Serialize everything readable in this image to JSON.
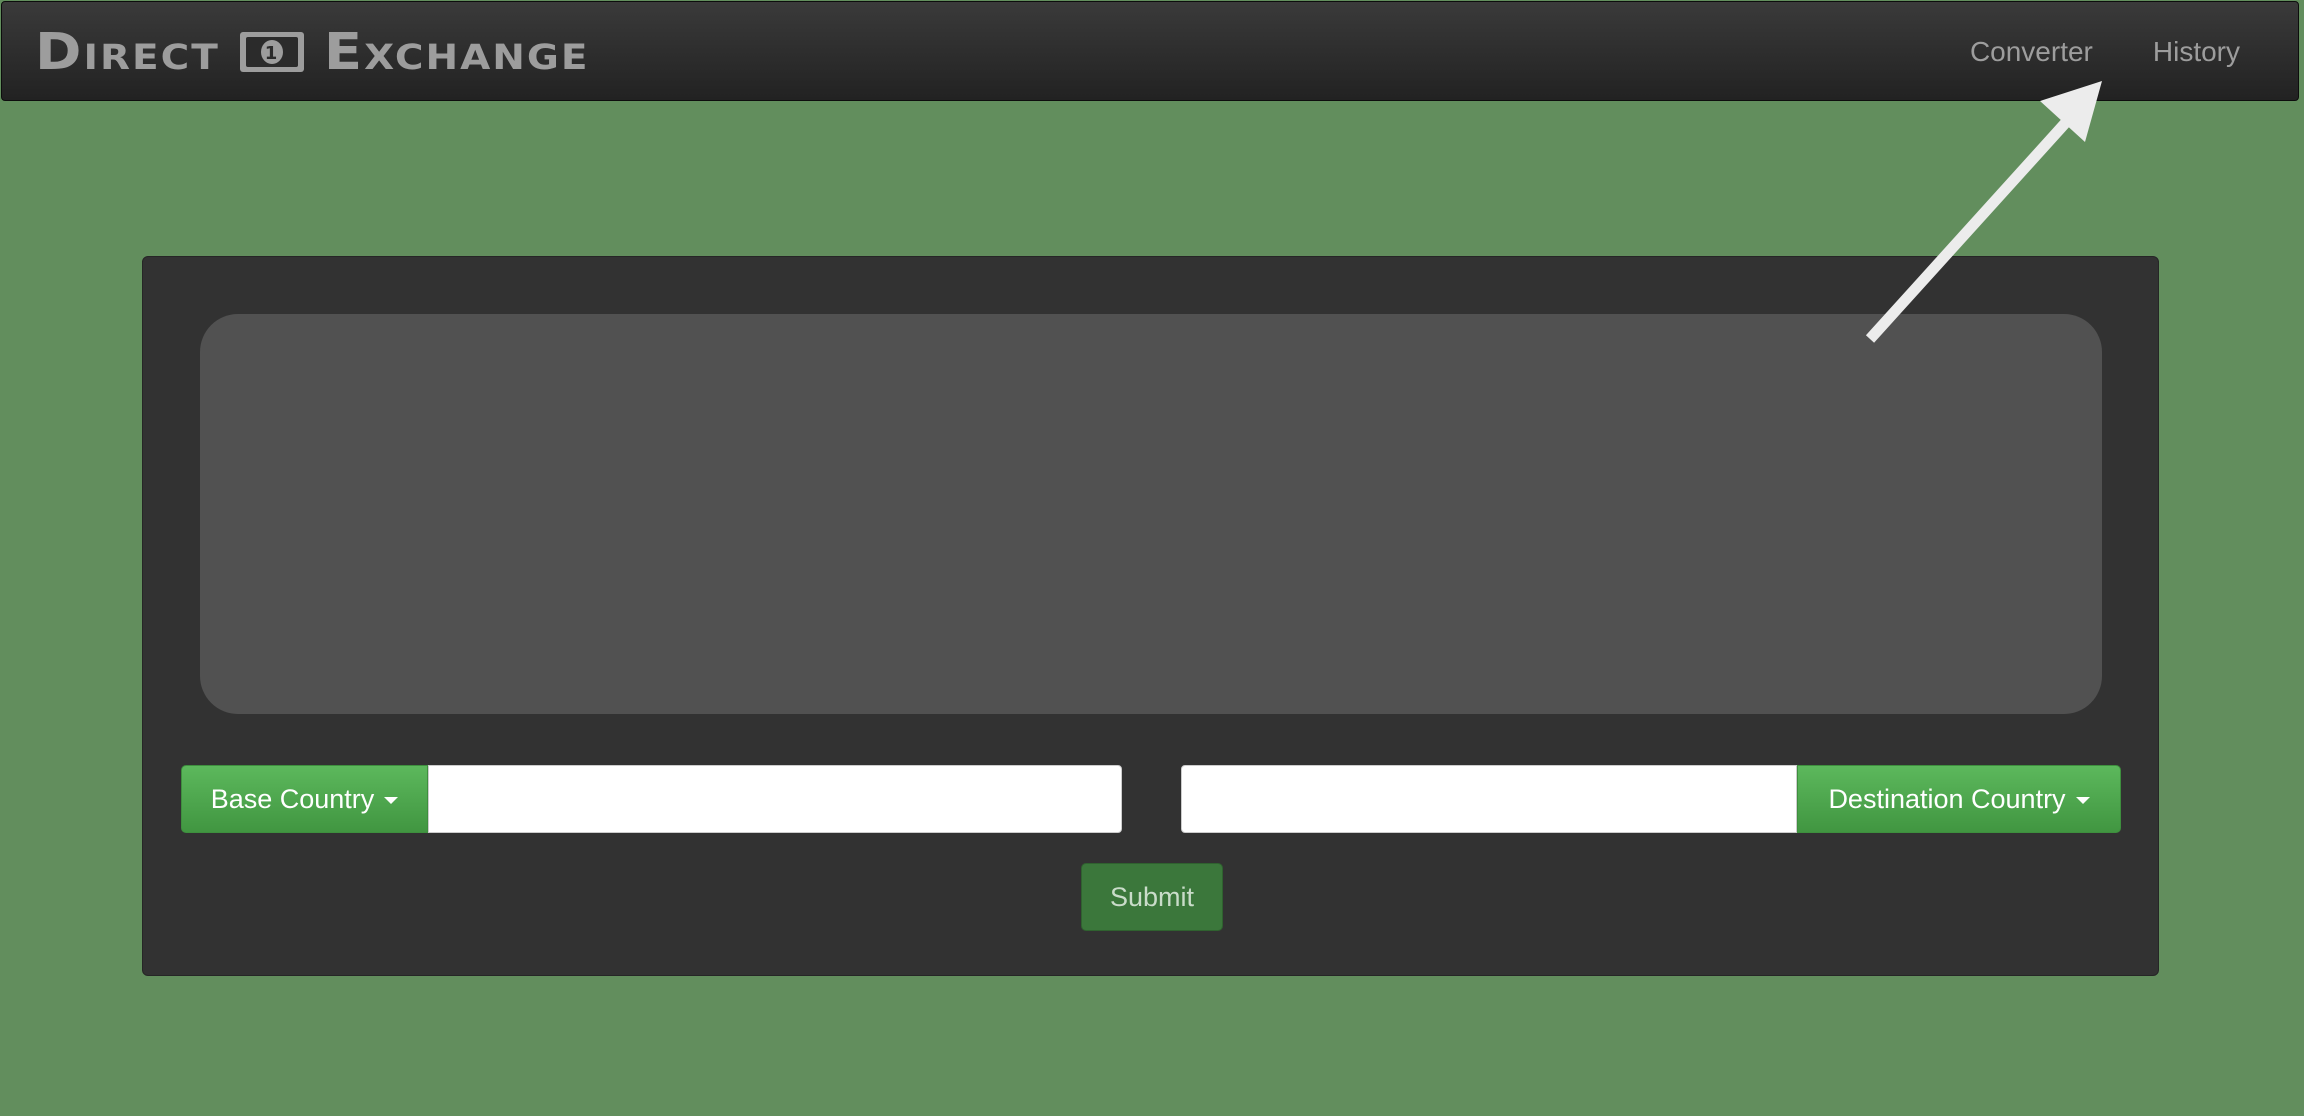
{
  "navbar": {
    "brand_left": "Direct",
    "brand_right": "Exchange",
    "brand_icon": "dollar-bill-icon",
    "links": [
      {
        "label": "Converter"
      },
      {
        "label": "History"
      }
    ]
  },
  "converter": {
    "base_button_label": "Base Country",
    "base_amount_value": "",
    "destination_amount_value": "",
    "destination_button_label": "Destination Country",
    "submit_label": "Submit"
  },
  "colors": {
    "background": "#628e5d",
    "navbar": "#2b2b2b",
    "panel": "#323232",
    "display_box": "#515151",
    "accent_green": "#5cb85c",
    "submit_green": "#3b773b"
  }
}
